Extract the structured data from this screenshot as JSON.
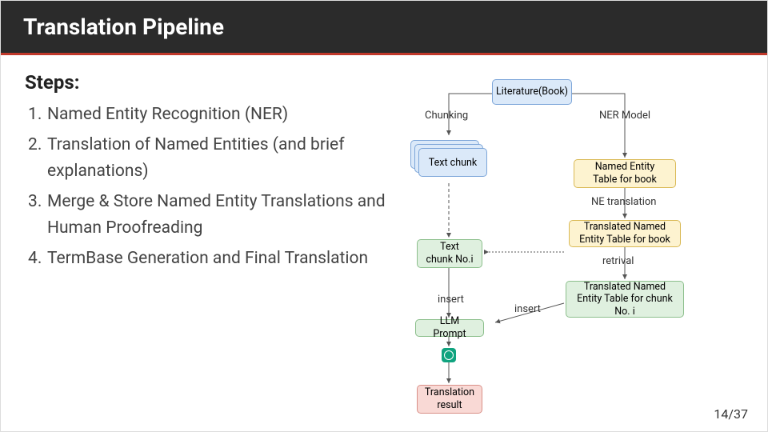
{
  "title": "Translation Pipeline",
  "steps_heading": "Steps:",
  "steps": [
    "Named Entity Recognition (NER)",
    "Translation of Named Entities (and brief explanations)",
    "Merge & Store Named Entity Translations and Human Proofreading",
    "TermBase Generation and Final Translation"
  ],
  "diagram": {
    "literature": "Literature(Book)",
    "chunking": "Chunking",
    "ner_model": "NER Model",
    "text_chunk": "Text chunk",
    "ne_table": "Named Entity Table for book",
    "ne_translation": "NE translation",
    "translated_ne_table": "Translated Named Entity Table for book",
    "text_chunk_i": "Text chunk No.i",
    "retrieval": "retrival",
    "translated_chunk_table": "Translated Named Entity Table for chunk No. i",
    "insert1": "insert",
    "insert2": "insert",
    "llm_prompt": "LLM Prompt",
    "translation_result": "Translation result"
  },
  "page": "14/37"
}
